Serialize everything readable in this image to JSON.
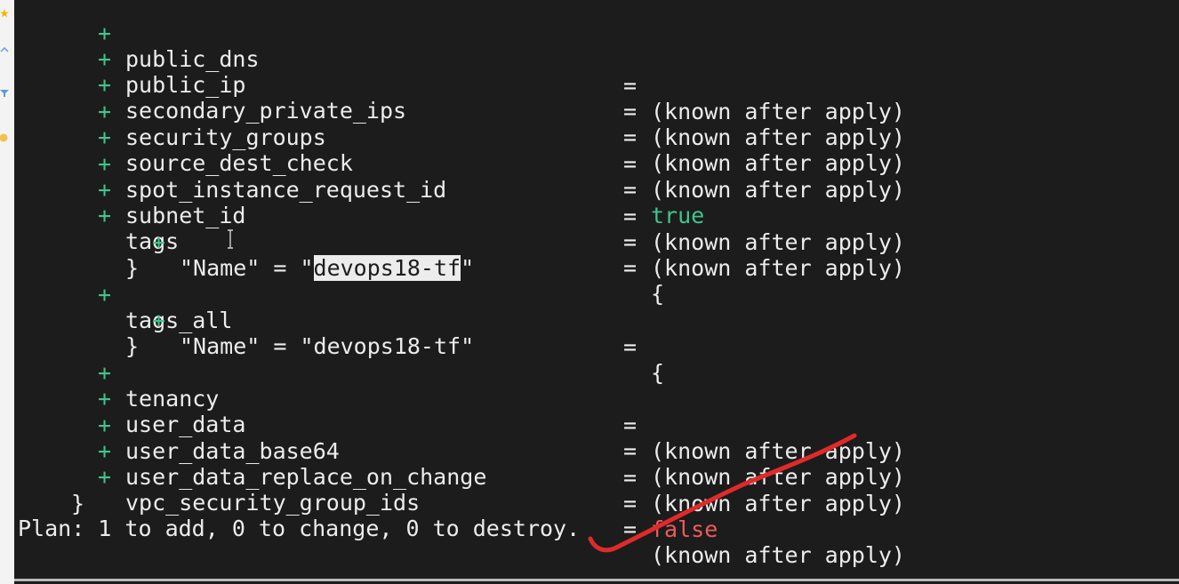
{
  "sidebar": {
    "icons": [
      "star-icon",
      "arrow-icon",
      "filter-icon",
      "circle-icon"
    ],
    "colors": {
      "star": "#f4b400",
      "arrow": "#6aa7e8",
      "filter": "#5b9bd5",
      "circle": "#f2c14e"
    }
  },
  "terminal": {
    "lines": [
      {
        "plus": "+",
        "key": "public_dns",
        "eq": "=",
        "value": "(known after apply)"
      },
      {
        "plus": "+",
        "key": "public_ip",
        "eq": "=",
        "value": "(known after apply)"
      },
      {
        "plus": "+",
        "key": "secondary_private_ips",
        "eq": "=",
        "value": "(known after apply)"
      },
      {
        "plus": "+",
        "key": "security_groups",
        "eq": "=",
        "value": "(known after apply)"
      },
      {
        "plus": "+",
        "key": "source_dest_check",
        "eq": "=",
        "value": "true"
      },
      {
        "plus": "+",
        "key": "spot_instance_request_id",
        "eq": "=",
        "value": "(known after apply)"
      },
      {
        "plus": "+",
        "key": "subnet_id",
        "eq": "=",
        "value": "(known after apply)"
      },
      {
        "plus": "+",
        "key": "tags",
        "eq": "=",
        "value": "{"
      },
      {
        "plus": "+",
        "key": "\"Name\" = \"",
        "highlight": "devops18-tf",
        "after": "\""
      },
      {
        "key": "}"
      },
      {
        "plus": "+",
        "key": "tags_all",
        "eq": "=",
        "value": "{"
      },
      {
        "plus": "+",
        "key": "\"Name\" = \"devops18-tf\""
      },
      {
        "key": "}"
      },
      {
        "plus": "+",
        "key": "tenancy",
        "eq": "=",
        "value": "(known after apply)"
      },
      {
        "plus": "+",
        "key": "user_data",
        "eq": "=",
        "value": "(known after apply)"
      },
      {
        "plus": "+",
        "key": "user_data_base64",
        "eq": "=",
        "value": "(known after apply)"
      },
      {
        "plus": "+",
        "key": "user_data_replace_on_change",
        "eq": "=",
        "value": "false"
      },
      {
        "plus": "+",
        "key": "vpc_security_group_ids",
        "eq": "=",
        "value": "(known after apply)"
      },
      {
        "key": "}"
      }
    ],
    "plan_summary": "Plan: 1 to add, 0 to change, 0 to destroy.",
    "colors": {
      "background": "#1c1c1c",
      "text": "#ececec",
      "added": "#3ec58f",
      "false_value": "#f05a5a",
      "annotation": "#e02a2a"
    }
  }
}
